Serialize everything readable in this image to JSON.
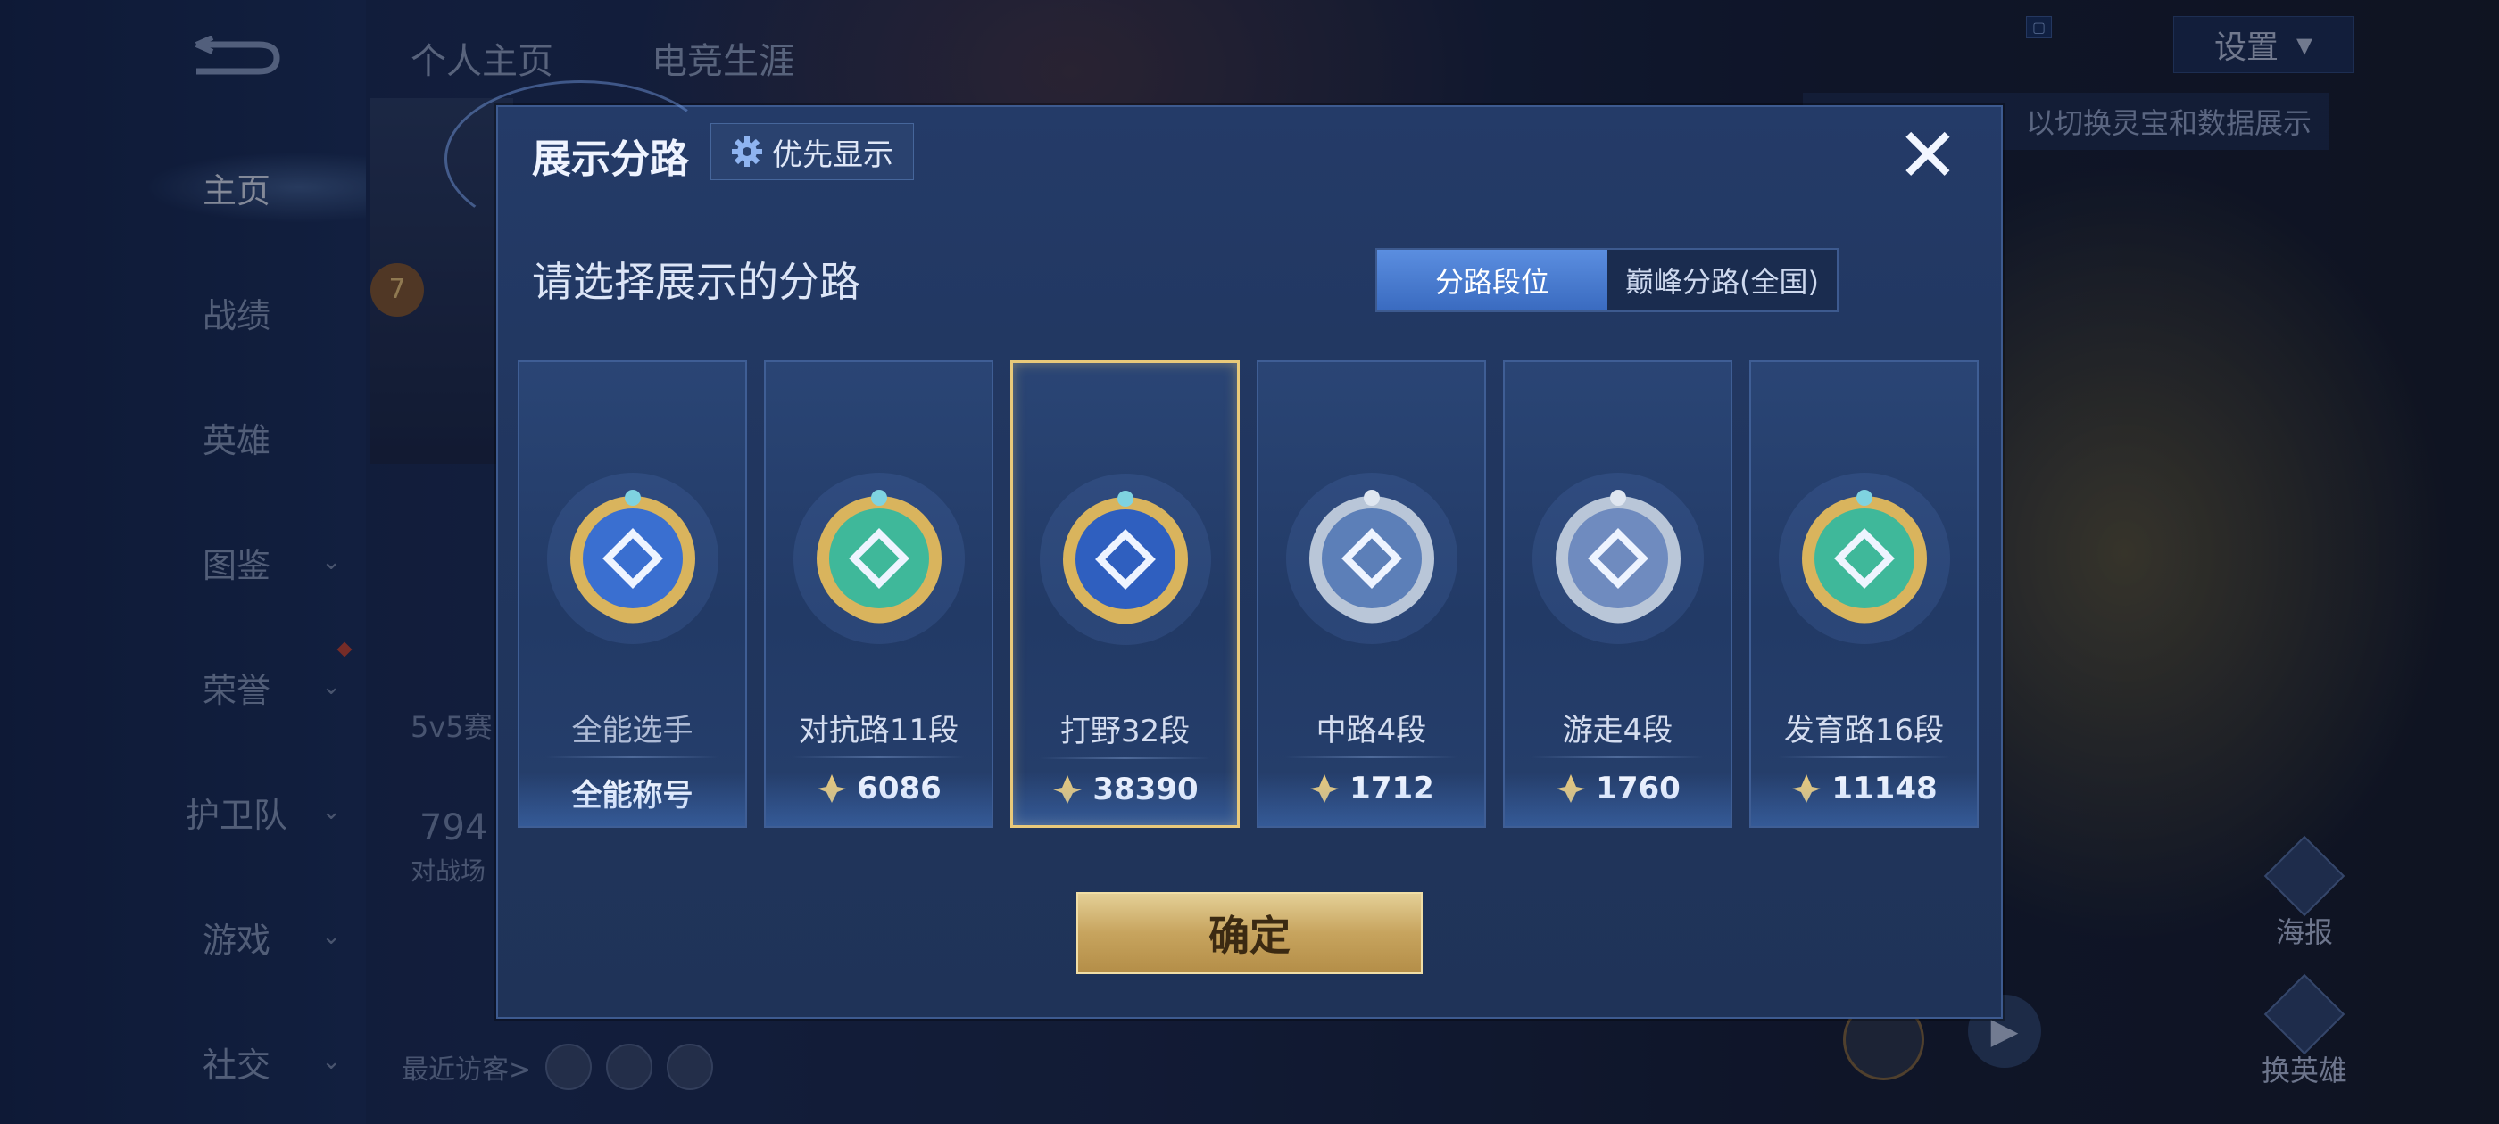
{
  "sidebar": {
    "items": [
      {
        "label": "主页",
        "active": true,
        "chevron": false
      },
      {
        "label": "战绩",
        "active": false,
        "chevron": false
      },
      {
        "label": "英雄",
        "active": false,
        "chevron": false
      },
      {
        "label": "图鉴",
        "active": false,
        "chevron": true
      },
      {
        "label": "荣誉",
        "active": false,
        "chevron": true
      },
      {
        "label": "护卫队",
        "active": false,
        "chevron": true
      },
      {
        "label": "游戏",
        "active": false,
        "chevron": true
      },
      {
        "label": "社交",
        "active": false,
        "chevron": true
      }
    ]
  },
  "top_tabs": [
    "个人主页",
    "电竞生涯"
  ],
  "header": {
    "settings_label": "设置",
    "hint_text": "以切换灵宝和数据展示"
  },
  "background_peek": {
    "mode_text": "5v5赛",
    "count_text": "794",
    "battle_text": "对战场",
    "level": "7",
    "recent_visitors": "最近访客>"
  },
  "right_panel": {
    "poster_label": "海报",
    "switch_hero_label": "换英雄"
  },
  "dialog": {
    "title": "展示分路",
    "priority_label": "优先显示",
    "subtitle": "请选择展示的分路",
    "segment": {
      "options": [
        "分路段位",
        "巅峰分路(全国)"
      ],
      "active_index": 0
    },
    "cards": [
      {
        "lane": "全能选手",
        "value": "全能称号",
        "has_points_icon": false,
        "selected": false,
        "badge_color": "#3a6fd0",
        "badge_type": "all-round"
      },
      {
        "lane": "对抗路11段",
        "value": "6086",
        "has_points_icon": true,
        "selected": false,
        "badge_color": "#3fb89a",
        "badge_type": "clash-lane"
      },
      {
        "lane": "打野32段",
        "value": "38390",
        "has_points_icon": true,
        "selected": true,
        "badge_color": "#2f5fbf",
        "badge_type": "jungle"
      },
      {
        "lane": "中路4段",
        "value": "1712",
        "has_points_icon": true,
        "selected": false,
        "badge_color": "#5c7fb8",
        "badge_type": "mid-lane"
      },
      {
        "lane": "游走4段",
        "value": "1760",
        "has_points_icon": true,
        "selected": false,
        "badge_color": "#6f8bbf",
        "badge_type": "roam"
      },
      {
        "lane": "发育路16段",
        "value": "11148",
        "has_points_icon": true,
        "selected": false,
        "badge_color": "#3fb89a",
        "badge_type": "farm-lane"
      }
    ],
    "confirm_label": "确定"
  },
  "colors": {
    "accent_gold": "#e9c97a",
    "segment_active": "#4a7ed6"
  }
}
